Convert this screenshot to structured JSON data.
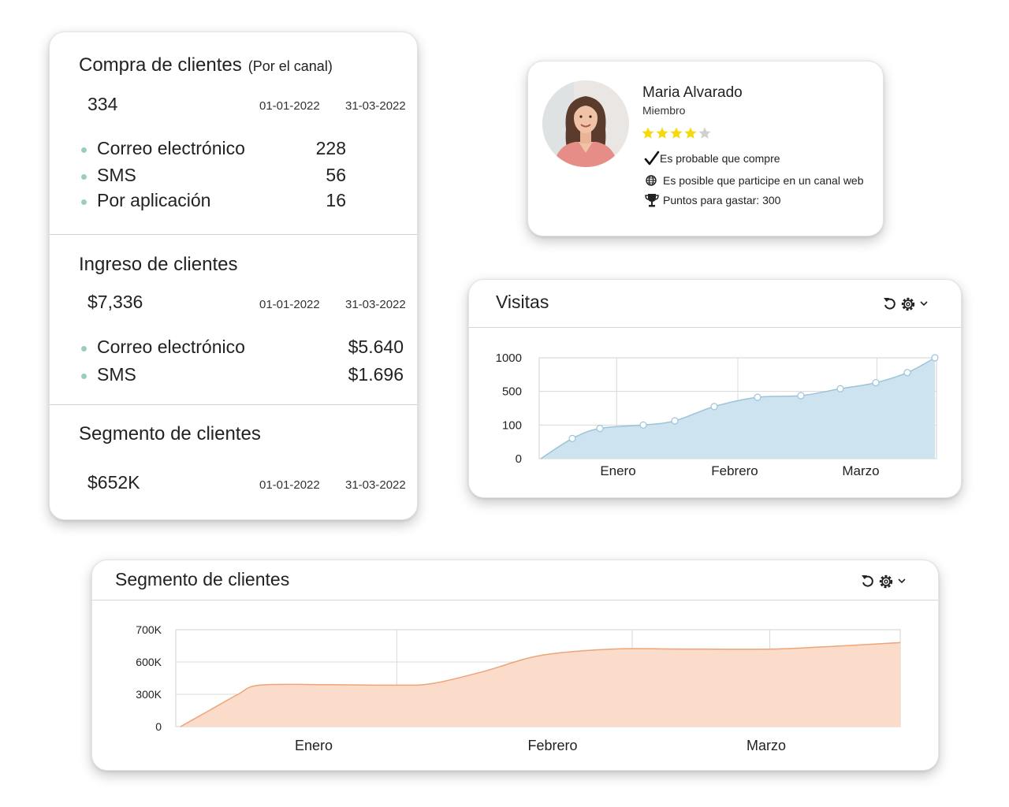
{
  "purchases": {
    "title": "Compra de clientes",
    "subtitle": "(Por el canal)",
    "total": "334",
    "date_from": "01-01-2022",
    "date_to": "31-03-2022",
    "channels": [
      {
        "label": "Correo electrónico",
        "value": "228"
      },
      {
        "label": "SMS",
        "value": "56"
      },
      {
        "label": "Por aplicación",
        "value": "16"
      }
    ]
  },
  "revenue": {
    "title": "Ingreso de clientes",
    "total": "$7,336",
    "date_from": "01-01-2022",
    "date_to": "31-03-2022",
    "channels": [
      {
        "label": "Correo electrónico",
        "value": "$5.640"
      },
      {
        "label": "SMS",
        "value": "$1.696"
      }
    ]
  },
  "segment_summary": {
    "title": "Segmento de clientes",
    "total": "$652K",
    "date_from": "01-01-2022",
    "date_to": "31-03-2022"
  },
  "profile": {
    "name": "Maria Alvarado",
    "role": "Miembro",
    "rating": 4,
    "rating_max": 5,
    "star_color": "#f5d90a",
    "star_empty_color": "#d0d0d0",
    "likely_buy": "Es probable que compre",
    "web_channel": "Es posible que participe en un canal web",
    "points": "Puntos para gastar: 300"
  },
  "icons": [
    "refresh-icon",
    "gear-icon",
    "chevron-down-icon",
    "check-icon",
    "globe-icon",
    "trophy-icon",
    "star-icon"
  ],
  "colors": {
    "bullet": "#9bcfb9",
    "visits_fill": "#cde3ef",
    "visits_line": "#9cc4d8",
    "segment_fill": "#fbdccb",
    "segment_line": "#eda477"
  },
  "visits_chart": {
    "title": "Visitas"
  },
  "segment_chart": {
    "title": "Segmento de clientes"
  },
  "chart_data": [
    {
      "type": "area",
      "title": "Visitas",
      "xlabel": "",
      "ylabel": "",
      "x_tick_labels": [
        "Enero",
        "Febrero",
        "Marzo"
      ],
      "y_tick_labels": [
        "0",
        "100",
        "500",
        "1000"
      ],
      "y_scale": "nonlinear (ticks evenly spaced: 0, 100, 500, 1000)",
      "grid": true,
      "markers": true,
      "x": [
        0,
        0.08,
        0.15,
        0.26,
        0.34,
        0.44,
        0.55,
        0.66,
        0.76,
        0.85,
        0.93,
        1.0
      ],
      "y": [
        0,
        60,
        90,
        100,
        150,
        320,
        430,
        450,
        540,
        630,
        780,
        1000
      ]
    },
    {
      "type": "area",
      "title": "Segmento de clientes",
      "xlabel": "",
      "ylabel": "",
      "x_tick_labels": [
        "Enero",
        "Febrero",
        "Marzo"
      ],
      "y_tick_labels": [
        "0",
        "300K",
        "600K",
        "700K"
      ],
      "y_scale": "nonlinear (ticks evenly spaced: 0, 300K, 600K, 700K)",
      "grid": true,
      "markers": false,
      "x": [
        0,
        0.04,
        0.08,
        0.11,
        0.2,
        0.3,
        0.35,
        0.42,
        0.5,
        0.6,
        0.7,
        0.82,
        0.92,
        1.0
      ],
      "y": [
        0,
        150000,
        300000,
        385000,
        390000,
        385000,
        400000,
        510000,
        620000,
        640000,
        640000,
        640000,
        650000,
        660000
      ]
    }
  ]
}
